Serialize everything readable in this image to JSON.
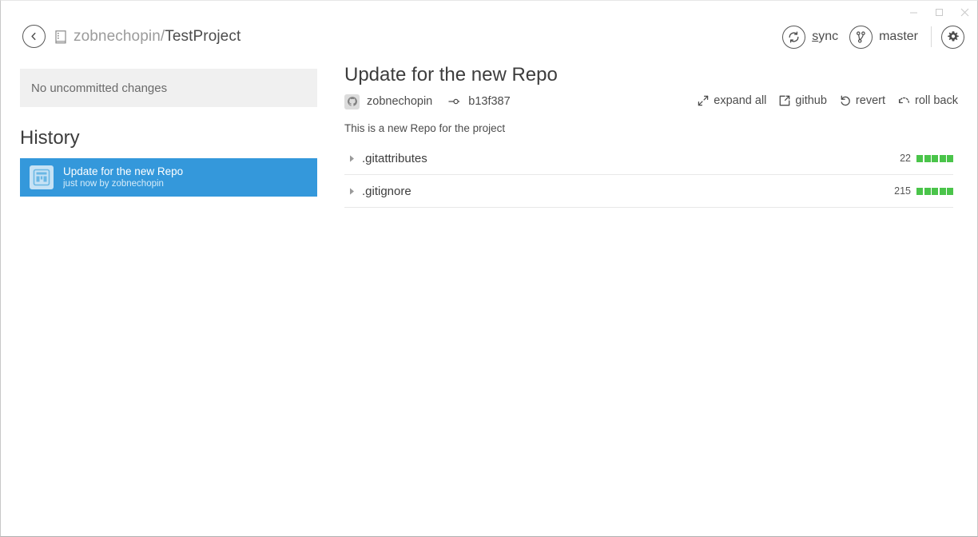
{
  "window": {
    "controls": [
      {
        "name": "minimize",
        "glyph": "minimize-icon"
      },
      {
        "name": "maximize",
        "glyph": "maximize-icon"
      },
      {
        "name": "close",
        "glyph": "close-icon"
      }
    ]
  },
  "topbar": {
    "back_icon": "chevron-left-icon",
    "repo_icon": "repo-book-icon",
    "owner": "zobnechopin/",
    "project": "TestProject",
    "sync": {
      "icon": "sync-icon",
      "accel": "s",
      "rest": "ync"
    },
    "branch": {
      "icon": "branch-icon",
      "label": "master"
    },
    "settings_icon": "gear-icon"
  },
  "sidebar": {
    "uncommitted_label": "No uncommitted changes",
    "history_label": "History",
    "commits": [
      {
        "title": "Update for the new Repo",
        "meta": "just now by zobnechopin",
        "avatar_icon": "avatar-placeholder-icon"
      }
    ]
  },
  "main": {
    "commit_title": "Update for the new Repo",
    "author": "zobnechopin",
    "author_avatar_icon": "github-mark-icon",
    "sha_icon": "commit-node-icon",
    "sha": "b13f387",
    "description": "This is a new Repo for the project",
    "actions": [
      {
        "label": "expand all",
        "icon": "expand-arrows-icon"
      },
      {
        "label": "github",
        "icon": "external-link-icon"
      },
      {
        "label": "revert",
        "icon": "revert-arrow-icon"
      },
      {
        "label": "roll back",
        "icon": "roll-back-icon"
      }
    ]
  },
  "files": [
    {
      "name": ".gitattributes",
      "count": "22",
      "squares": 5,
      "disclosure_icon": "triangle-right-icon"
    },
    {
      "name": ".gitignore",
      "count": "215",
      "squares": 5,
      "disclosure_icon": "triangle-right-icon"
    }
  ],
  "colors": {
    "selection_blue": "#3498db",
    "diff_green": "#4ac44a",
    "panel_gray": "#f0f0f0",
    "text_dark": "#3d3d3d",
    "text_muted": "#9b9b9b"
  }
}
